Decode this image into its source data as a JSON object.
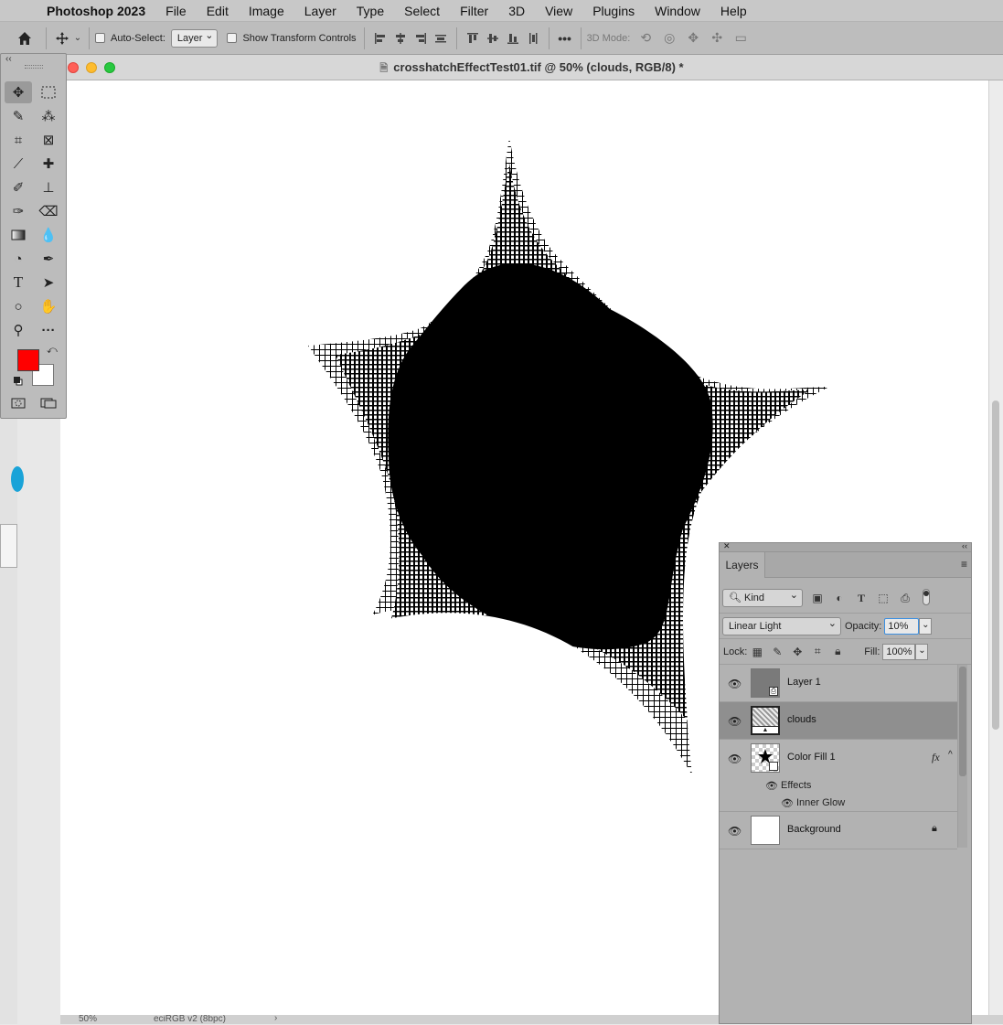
{
  "menubar": {
    "app_name": "Photoshop 2023",
    "items": [
      "File",
      "Edit",
      "Image",
      "Layer",
      "Type",
      "Select",
      "Filter",
      "3D",
      "View",
      "Plugins",
      "Window",
      "Help"
    ]
  },
  "options_bar": {
    "auto_select_label": "Auto-Select:",
    "auto_select_value": "Layer",
    "show_transform_label": "Show Transform Controls",
    "mode_3d_label": "3D Mode:",
    "more_label": "•••"
  },
  "document": {
    "title": "crosshatchEffectTest01.tif @ 50% (clouds, RGB/8) *",
    "zoom": "50%",
    "profile": "eciRGB v2 (8bpc)"
  },
  "tools": {
    "foreground_color": "#ff0000",
    "background_color": "#ffffff"
  },
  "layers_panel": {
    "tab_label": "Layers",
    "filter_kind": "Kind",
    "blend_mode": "Linear Light",
    "opacity_label": "Opacity:",
    "opacity_value": "10%",
    "lock_label": "Lock:",
    "fill_label": "Fill:",
    "fill_value": "100%",
    "layers": [
      {
        "name": "Layer 1"
      },
      {
        "name": "clouds",
        "selected": true
      },
      {
        "name": "Color Fill 1",
        "fx": "fx"
      },
      {
        "name": "Background",
        "locked": true
      }
    ],
    "effects_label": "Effects",
    "inner_glow_label": "Inner Glow"
  },
  "colors": {
    "menubar_bg": "#c8c8c8",
    "panel_bg": "#b2b2b2",
    "selected_layer_bg": "#8f8f8f"
  }
}
